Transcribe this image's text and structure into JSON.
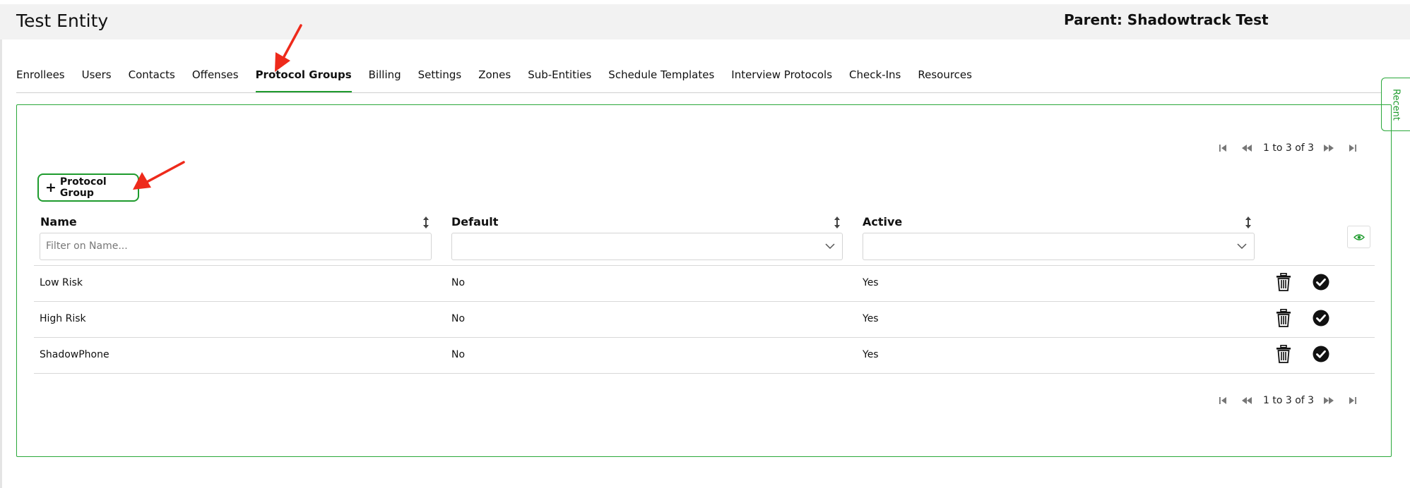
{
  "header": {
    "entity_title": "Test Entity",
    "parent_label": "Parent: Shadowtrack Test"
  },
  "tabs": [
    {
      "label": "Enrollees",
      "active": false
    },
    {
      "label": "Users",
      "active": false
    },
    {
      "label": "Contacts",
      "active": false
    },
    {
      "label": "Offenses",
      "active": false
    },
    {
      "label": "Protocol Groups",
      "active": true
    },
    {
      "label": "Billing",
      "active": false
    },
    {
      "label": "Settings",
      "active": false
    },
    {
      "label": "Zones",
      "active": false
    },
    {
      "label": "Sub-Entities",
      "active": false
    },
    {
      "label": "Schedule Templates",
      "active": false
    },
    {
      "label": "Interview Protocols",
      "active": false
    },
    {
      "label": "Check-Ins",
      "active": false
    },
    {
      "label": "Resources",
      "active": false
    }
  ],
  "recent_tab": {
    "label": "Recent"
  },
  "pager": {
    "text": "1 to 3 of 3"
  },
  "toolbar": {
    "add_label": "Protocol Group"
  },
  "table": {
    "columns": [
      {
        "label": "Name",
        "filter_placeholder": "Filter on Name...",
        "filter_type": "text"
      },
      {
        "label": "Default",
        "filter_value": "",
        "filter_type": "select"
      },
      {
        "label": "Active",
        "filter_value": "",
        "filter_type": "select"
      }
    ],
    "rows": [
      {
        "name": "Low Risk",
        "default": "No",
        "active": "Yes"
      },
      {
        "name": "High Risk",
        "default": "No",
        "active": "Yes"
      },
      {
        "name": "ShadowPhone",
        "default": "No",
        "active": "Yes"
      }
    ]
  },
  "icons": {
    "add": "plus-icon",
    "sort": "sort-icon",
    "dropdown": "chevron-down-icon",
    "column_visibility": "eye-icon",
    "delete": "trash-icon",
    "activate": "check-circle-icon",
    "pager_first": "first-page-icon",
    "pager_prev": "previous-page-icon",
    "pager_next": "next-page-icon",
    "pager_last": "last-page-icon",
    "annotation": "red-arrow-icon"
  },
  "colors": {
    "accent": "#1e9b2d",
    "annotation_arrow": "#ee2a1b",
    "header_bg": "#f2f2f2"
  }
}
